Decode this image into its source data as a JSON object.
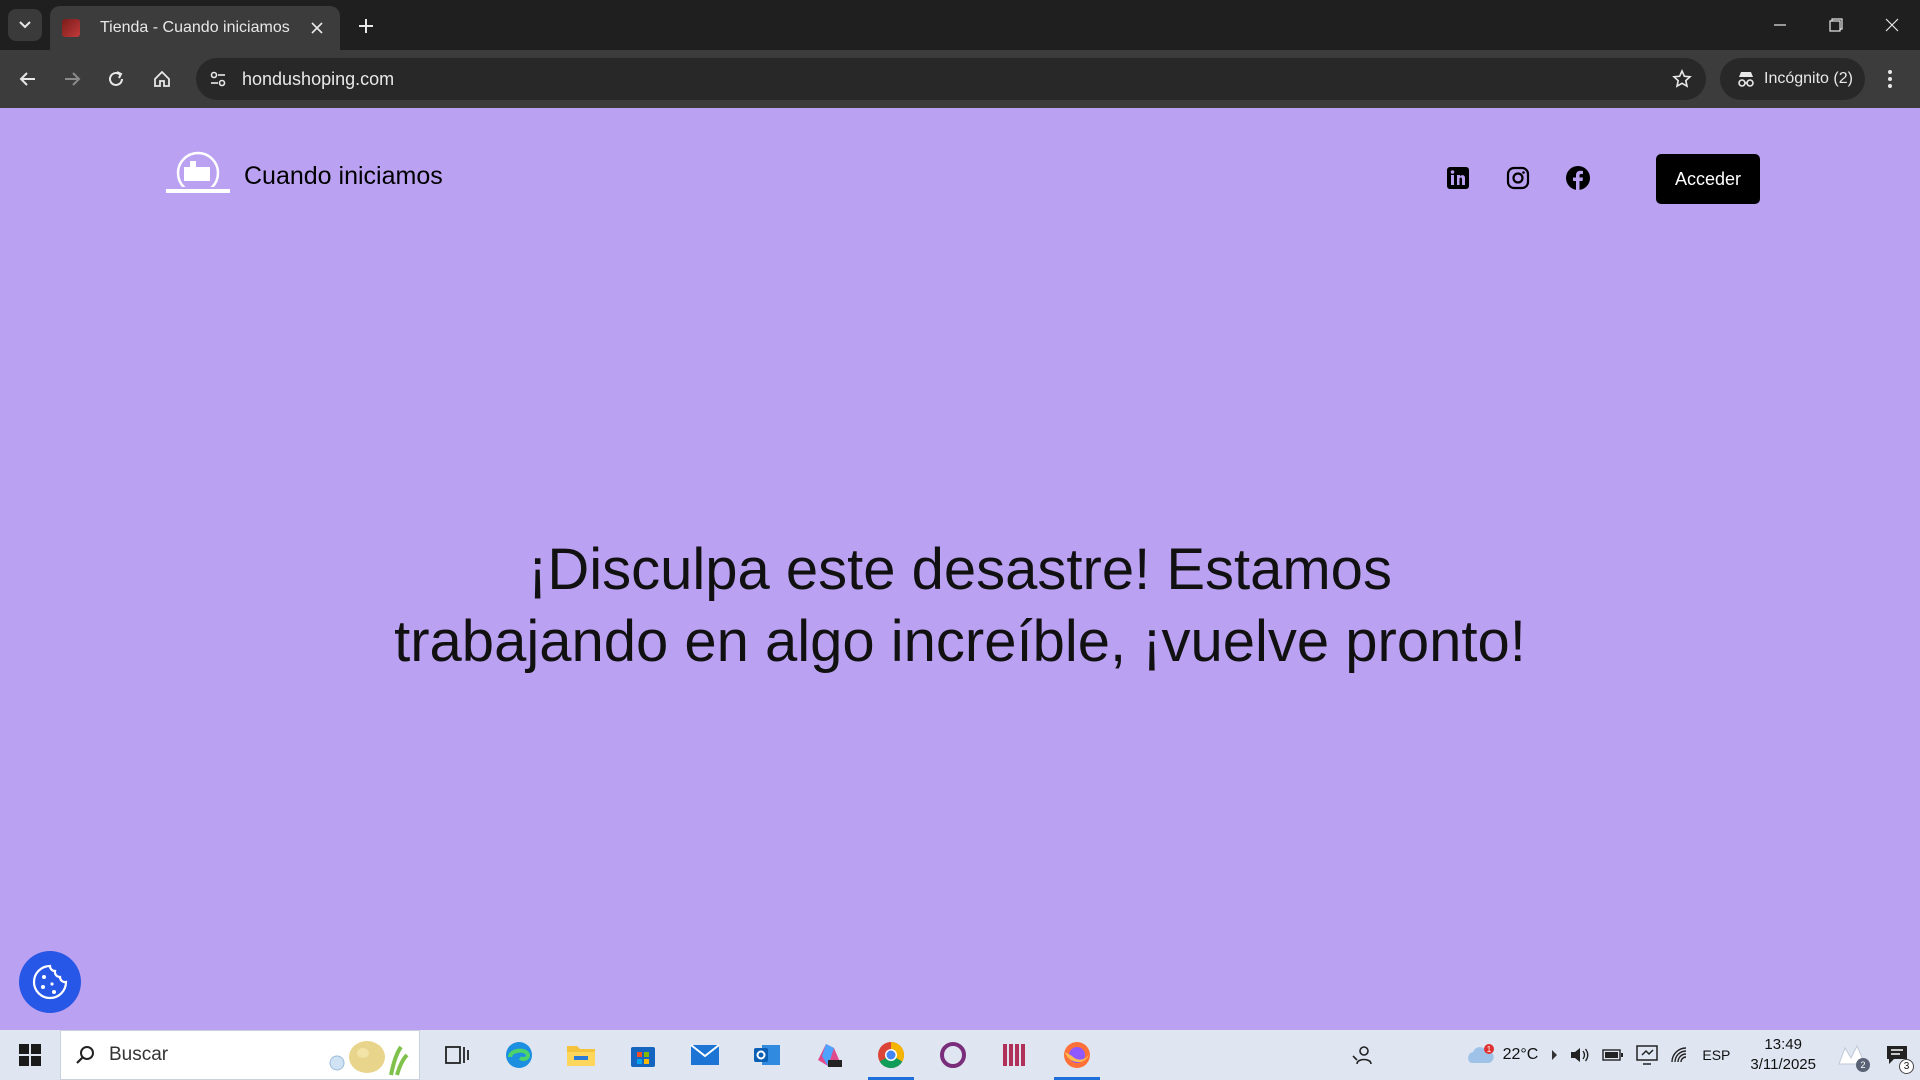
{
  "browser": {
    "tab_title": "Tienda - Cuando iniciamos",
    "url": "hondushoping.com",
    "incognito_label": "Incógnito (2)"
  },
  "site": {
    "title": "Cuando iniciamos",
    "login_label": "Acceder",
    "headline_line1": "¡Disculpa este desastre! Estamos",
    "headline_line2": "trabajando en algo increíble, ¡vuelve pronto!",
    "socials": [
      "linkedin-icon",
      "instagram-icon",
      "facebook-icon"
    ]
  },
  "taskbar": {
    "search_placeholder": "Buscar",
    "weather_temp": "22°C",
    "weather_alert": "1",
    "language": "ESP",
    "time": "13:49",
    "date": "3/11/2025",
    "notifications_count": "3",
    "widget_count": "2"
  },
  "colors": {
    "page_background": "#bba1f2",
    "button": "#000000",
    "cookie_button": "#2757e6"
  }
}
